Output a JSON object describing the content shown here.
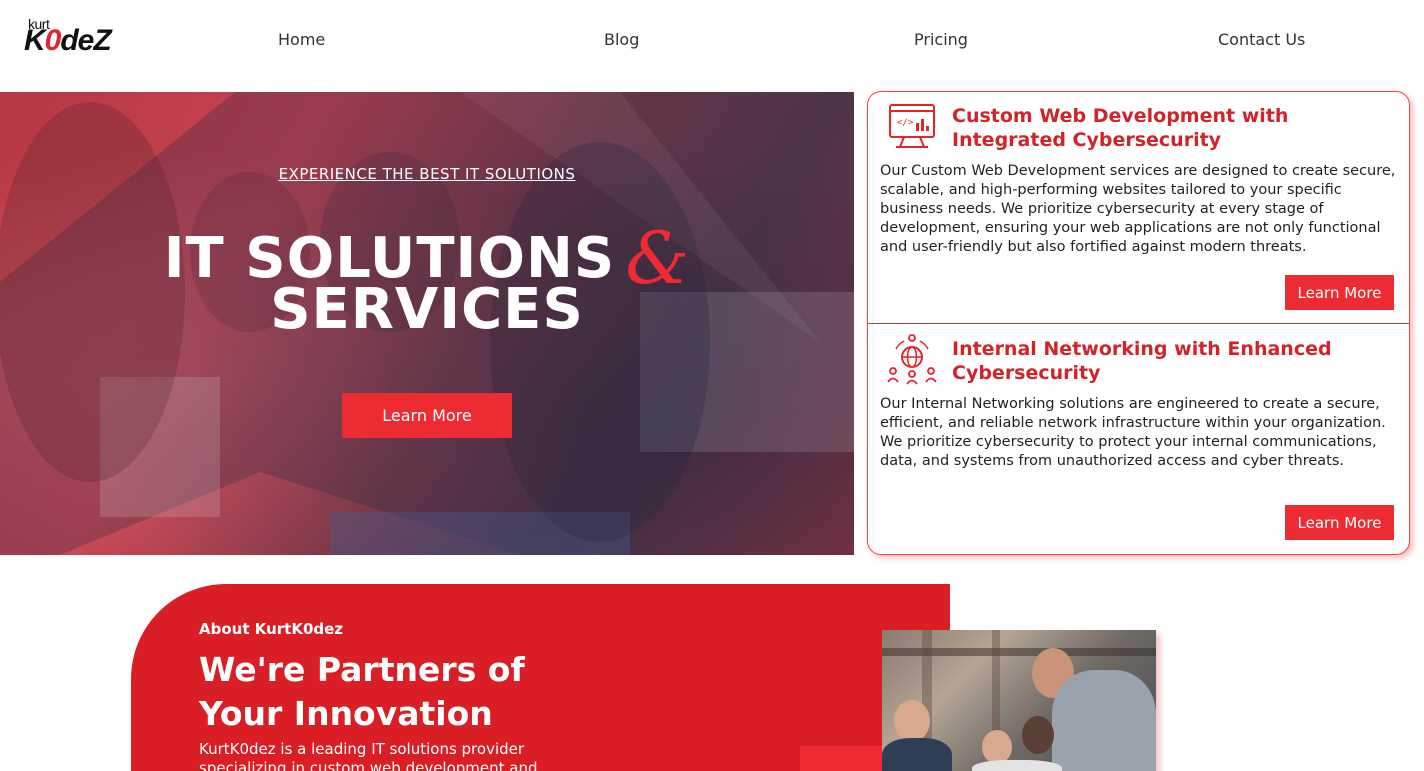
{
  "brand": {
    "small": "kurt",
    "big_prefix": "K",
    "big_zero": "0",
    "big_suffix": "de",
    "big_z": "Z"
  },
  "nav": {
    "links": [
      "Home",
      "Blog",
      "Pricing",
      "Contact Us"
    ]
  },
  "hero": {
    "eyebrow": "EXPERIENCE THE BEST IT SOLUTIONS",
    "title_line1": "IT SOLUTIONS",
    "ampersand": "&",
    "title_line2": "SERVICES",
    "cta": "Learn More"
  },
  "services": [
    {
      "icon": "web-development-icon",
      "title": "Custom Web Development with Integrated Cybersecurity",
      "description": "Our Custom Web Development services are designed to create secure, scalable, and high-performing websites tailored to your specific business needs. We prioritize cybersecurity at every stage of development, ensuring your web applications are not only functional and user-friendly but also fortified against modern threats.",
      "button": "Learn More"
    },
    {
      "icon": "network-icon",
      "title": "Internal Networking with Enhanced Cybersecurity",
      "description": "Our Internal Networking solutions are engineered to create a secure, efficient, and reliable network infrastructure within your organization. We prioritize cybersecurity to protect your internal communications, data, and systems from unauthorized access and cyber threats.",
      "button": "Learn More"
    }
  ],
  "about": {
    "kicker": "About KurtK0dez",
    "headline": "We're Partners of Your Innovation",
    "body": "KurtK0dez is a leading IT solutions provider specializing in custom web development and"
  },
  "colors": {
    "accent": "#ec2b32",
    "about_bg": "#d91f25",
    "heading_red": "#d2232a"
  }
}
